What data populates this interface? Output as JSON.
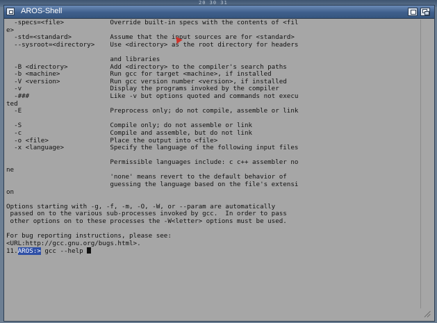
{
  "desktop": {
    "clock_text": "20 30 31"
  },
  "window": {
    "title": "AROS-Shell"
  },
  "console": {
    "lines": [
      "  -specs=<file>            Override built-in specs with the contents of <fil",
      "e>",
      "  -std=<standard>          Assume that the input sources are for <standard>",
      "  --sysroot=<directory>    Use <directory> as the root directory for headers",
      "",
      "                           and libraries",
      "  -B <directory>           Add <directory> to the compiler's search paths",
      "  -b <machine>             Run gcc for target <machine>, if installed",
      "  -V <version>             Run gcc version number <version>, if installed",
      "  -v                       Display the programs invoked by the compiler",
      "  -###                     Like -v but options quoted and commands not execu",
      "ted",
      "  -E                       Preprocess only; do not compile, assemble or link",
      "",
      "  -S                       Compile only; do not assemble or link",
      "  -c                       Compile and assemble, but do not link",
      "  -o <file>                Place the output into <file>",
      "  -x <language>            Specify the language of the following input files",
      "",
      "                           Permissible languages include: c c++ assembler no",
      "ne",
      "                           'none' means revert to the default behavior of",
      "                           guessing the language based on the file's extensi",
      "on",
      "",
      "Options starting with -g, -f, -m, -O, -W, or --param are automatically",
      " passed on to the various sub-processes invoked by gcc.  In order to pass",
      " other options on to these processes the -W<letter> options must be used.",
      "",
      "For bug reporting instructions, please see:",
      "<URL:http://gcc.gnu.org/bugs.html>."
    ],
    "prompt_number": "11.",
    "prompt_label": "AROS:>",
    "command": " gcc --help "
  }
}
